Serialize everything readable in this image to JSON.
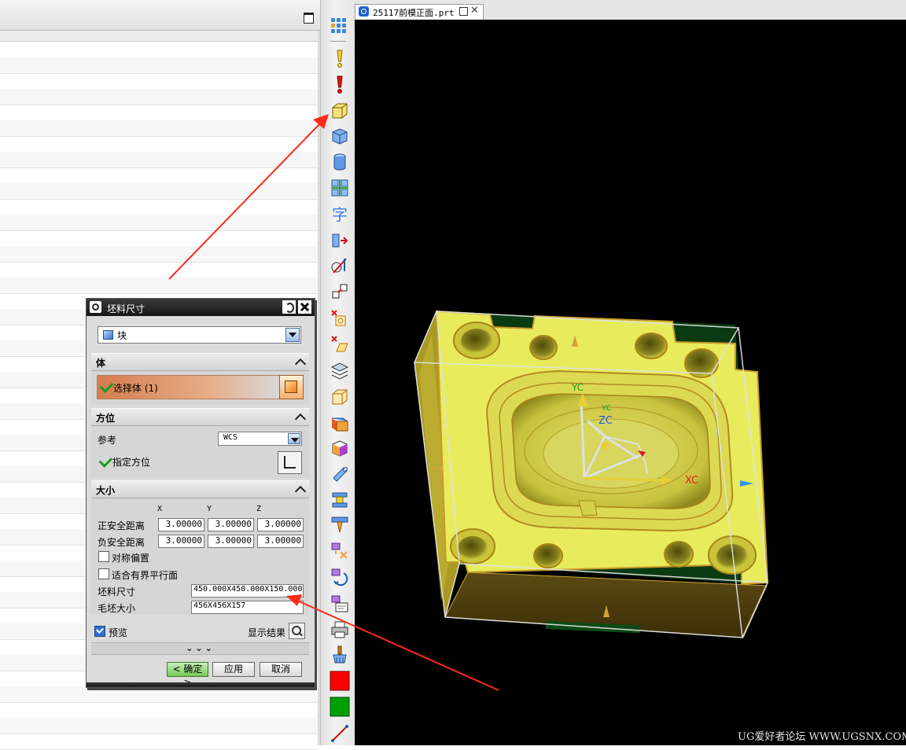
{
  "document_tab": {
    "title": "25117前模正面.prt",
    "pin_icon": "pin-icon",
    "close_glyph": "✕"
  },
  "toolbar": {
    "icons": [
      "grid-icon",
      "yellow-exclamation-icon",
      "red-exclamation-icon",
      "bounding-box-icon",
      "block-icon",
      "cylinder-icon",
      "split-body-icon",
      "text-icon",
      "extrude-arrow-icon",
      "split-plane-icon",
      "transform-icon",
      "delete-point-icon",
      "delete-face-icon",
      "layer-stack-icon",
      "wireframe-box-icon",
      "offset-face-icon",
      "cube-color-icon",
      "tube-icon",
      "mold-insert-icon",
      "ejector-pin-icon",
      "electrode-icon",
      "rotate-tool-icon",
      "drawing-icon",
      "printer-icon",
      "brush-icon",
      "red-color-icon",
      "green-color-icon",
      "line-icon"
    ],
    "red_color": "#ff0000",
    "green_color": "#00a000"
  },
  "dialog": {
    "title": "坯料尺寸",
    "type_value": "块",
    "sections": {
      "body": {
        "title": "体",
        "select_label": "选择体 (1)"
      },
      "orientation": {
        "title": "方位",
        "reference_label": "参考",
        "reference_value": "WCS",
        "specify_label": "指定方位"
      },
      "size": {
        "title": "大小",
        "col_x": "X",
        "col_y": "Y",
        "col_z": "Z",
        "positive_label": "正安全距离",
        "positive_values": [
          "3.00000",
          "3.00000",
          "3.00000"
        ],
        "negative_label": "负安全距离",
        "negative_values": [
          "3.00000",
          "3.00000",
          "3.00000"
        ],
        "symmetric_label": "对称偏置",
        "symmetric_checked": false,
        "fit_label": "适合有界平行面",
        "fit_checked": false,
        "stock_label": "坯料尺寸",
        "stock_value": "450.000X450.000X150.000",
        "blank_label": "毛坯大小",
        "blank_value": "456X456X157"
      }
    },
    "preview_label": "预览",
    "preview_checked": true,
    "show_result_label": "显示结果",
    "more_glyph": "⌄⌄⌄",
    "ok_label": "< 确定 >",
    "apply_label": "应用",
    "cancel_label": "取消"
  },
  "viewport": {
    "labels": {
      "xc": "XC",
      "yc_outer": "YC",
      "yc_inner": "YC",
      "zc": "ZC"
    },
    "background": "#000000",
    "part_color": "#e8ec5c"
  },
  "watermark": "UG爱好者论坛 WWW.UGSNX.COM",
  "annotation_color": "#ff2a1a"
}
